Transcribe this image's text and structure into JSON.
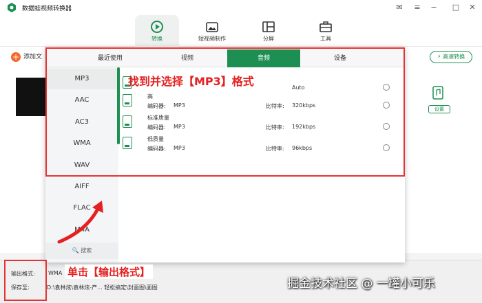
{
  "app": {
    "title": "数据蛙视频转换器"
  },
  "window_controls": [
    "mail-icon",
    "menu-icon",
    "minimize-icon",
    "maximize-icon",
    "close-icon"
  ],
  "nav": [
    {
      "label": "转换",
      "icon": "convert-icon",
      "active": true
    },
    {
      "label": "短视频制作",
      "icon": "video-maker-icon"
    },
    {
      "label": "分屏",
      "icon": "split-screen-icon"
    },
    {
      "label": "工具",
      "icon": "toolbox-icon"
    }
  ],
  "toolbar": {
    "add_file": "添加文",
    "fast_convert": "高速转换",
    "settings": "设置"
  },
  "panel": {
    "tabs": [
      "最近使用",
      "视频",
      "音频",
      "设备"
    ],
    "active_tab": "音频",
    "formats": [
      "MP3",
      "AAC",
      "AC3",
      "WMA",
      "WAV",
      "AIFF",
      "FLAC",
      "M4A"
    ],
    "selected_format": "MP3",
    "search": "搜索",
    "qualities": [
      {
        "name": "",
        "encoder_label": "",
        "encoder": "",
        "bitrate_label": "",
        "bitrate": "Auto"
      },
      {
        "name": "高",
        "encoder_label": "编码器:",
        "encoder": "MP3",
        "bitrate_label": "比特率:",
        "bitrate": "320kbps"
      },
      {
        "name": "标准质量",
        "encoder_label": "编码器:",
        "encoder": "MP3",
        "bitrate_label": "比特率:",
        "bitrate": "192kbps"
      },
      {
        "name": "低质量",
        "encoder_label": "编码器:",
        "encoder": "MP3",
        "bitrate_label": "比特率:",
        "bitrate": "96kbps"
      }
    ]
  },
  "bottom": {
    "output_format_label": "输出格式:",
    "output_format_value": "WMA",
    "save_to_label": "保存至:",
    "save_to_value": "D:\\袁林炫\\袁林炫-产... 轻松搞定\\封面图\\面图"
  },
  "annotations": {
    "top": "找到并选择【MP3】格式",
    "bottom": "单击【输出格式】"
  },
  "watermark": "掘金技术社区 @ 一罐小可乐",
  "colors": {
    "accent": "#1e8f52",
    "annotation_red": "#e53333"
  }
}
